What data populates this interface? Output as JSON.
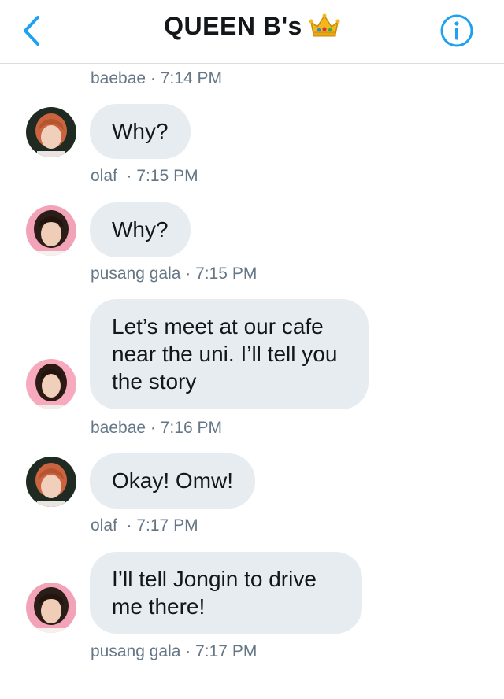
{
  "header": {
    "title": "QUEEN B's",
    "title_emoji": "crown"
  },
  "colors": {
    "accent": "#1da1f2",
    "bubble": "#e6ecf0",
    "meta": "#657786",
    "text": "#14171a"
  },
  "messages": [
    {
      "text": "Why?",
      "sender": "olaf",
      "time": "7:15 PM",
      "avatar": "person-red-hair"
    },
    {
      "text": "Why?",
      "sender": "pusang gala",
      "time": "7:15 PM",
      "avatar": "person-dark-hair"
    },
    {
      "text": "Let’s meet at our cafe near the uni. I’ll tell you the story",
      "sender": "baebae",
      "time": "7:16 PM",
      "avatar": "person-pink-bg"
    },
    {
      "text": "Okay! Omw!",
      "sender": "olaf",
      "time": "7:17 PM",
      "avatar": "person-red-hair"
    },
    {
      "text": "I’ll tell Jongin to drive me there!",
      "sender": "pusang gala",
      "time": "7:17 PM",
      "avatar": "person-dark-hair"
    }
  ],
  "top_meta": {
    "sender": "baebae",
    "time": "7:14 PM"
  }
}
